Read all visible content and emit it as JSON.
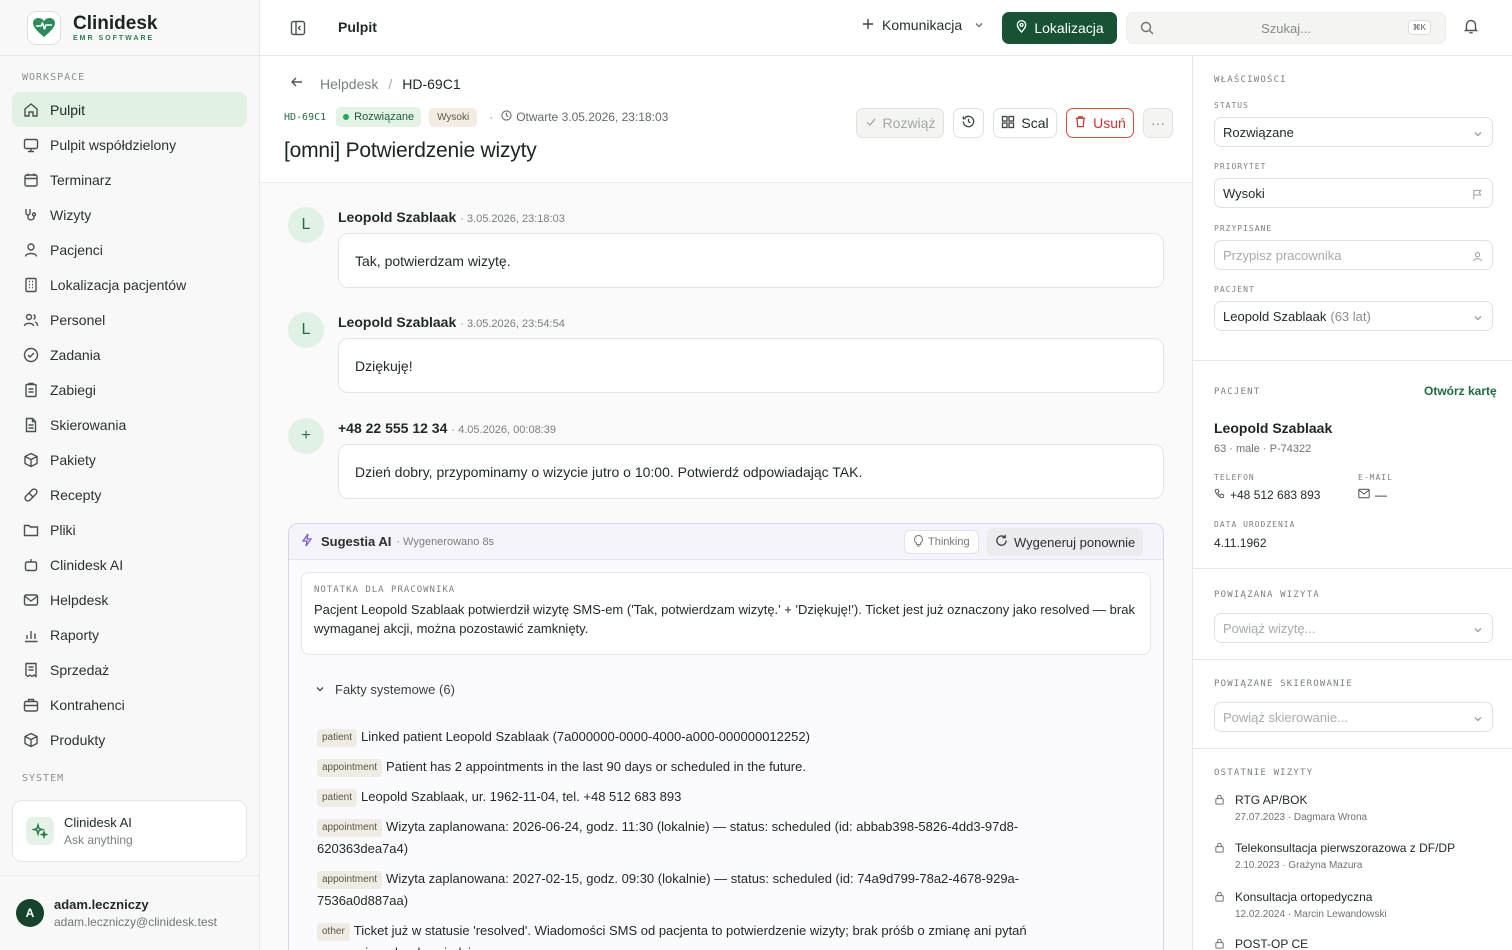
{
  "brand": {
    "name": "Clinidesk",
    "sub": "EMR SOFTWARE"
  },
  "sidebar": {
    "workspace_label": "WORKSPACE",
    "system_label": "SYSTEM",
    "items": [
      {
        "label": "Pulpit",
        "icon": "home-icon"
      },
      {
        "label": "Pulpit współdzielony",
        "icon": "monitor-icon"
      },
      {
        "label": "Terminarz",
        "icon": "calendar-icon"
      },
      {
        "label": "Wizyty",
        "icon": "stethoscope-icon"
      },
      {
        "label": "Pacjenci",
        "icon": "user-icon"
      },
      {
        "label": "Lokalizacja pacjentów",
        "icon": "building-icon"
      },
      {
        "label": "Personel",
        "icon": "users-icon"
      },
      {
        "label": "Zadania",
        "icon": "check-circle-icon"
      },
      {
        "label": "Zabiegi",
        "icon": "clipboard-icon"
      },
      {
        "label": "Skierowania",
        "icon": "file-icon"
      },
      {
        "label": "Pakiety",
        "icon": "package-icon"
      },
      {
        "label": "Recepty",
        "icon": "pill-icon"
      },
      {
        "label": "Pliki",
        "icon": "folder-icon"
      },
      {
        "label": "Clinidesk AI",
        "icon": "bot-icon"
      },
      {
        "label": "Helpdesk",
        "icon": "mail-icon"
      },
      {
        "label": "Raporty",
        "icon": "bar-chart-icon"
      },
      {
        "label": "Sprzedaż",
        "icon": "receipt-icon"
      },
      {
        "label": "Kontrahenci",
        "icon": "briefcase-icon"
      },
      {
        "label": "Produkty",
        "icon": "box-icon"
      }
    ],
    "ai_card": {
      "title": "Clinidesk AI",
      "subtitle": "Ask anything"
    },
    "user": {
      "initial": "A",
      "name": "adam.leczniczy",
      "email": "adam.leczniczy@clinidesk.test"
    }
  },
  "topbar": {
    "title": "Pulpit",
    "communication": "Komunikacja",
    "location": "Lokalizacja",
    "search_placeholder": "Szukaj...",
    "search_shortcut": "⌘K"
  },
  "ticket": {
    "breadcrumb_parent": "Helpdesk",
    "breadcrumb_current": "HD-69C1",
    "id": "HD-69C1",
    "status": "Rozwiązane",
    "priority": "Wysoki",
    "separator": "·",
    "opened": "Otwarte 3.05.2026, 23:18:03",
    "title": "[omni] Potwierdzenie wizyty",
    "actions": {
      "resolve": "Rozwiąż",
      "merge": "Scal",
      "delete": "Usuń",
      "more": "···"
    }
  },
  "messages": [
    {
      "avatar": "L",
      "author": "Leopold Szablaak",
      "time": "· 3.05.2026, 23:18:03",
      "text": "Tak, potwierdzam wizytę."
    },
    {
      "avatar": "L",
      "author": "Leopold Szablaak",
      "time": "· 3.05.2026, 23:54:54",
      "text": "Dziękuję!"
    },
    {
      "avatar": "+",
      "author": "+48 22 555 12 34",
      "time": "· 4.05.2026, 00:08:39",
      "text": "Dzień dobry, przypominamy o wizycie jutro o 10:00. Potwierdź odpowiadając TAK."
    }
  ],
  "ai": {
    "title": "Sugestia AI",
    "generated": "· Wygenerowano 8s",
    "thinking": "Thinking",
    "regenerate": "Wygeneruj ponownie",
    "note_label": "NOTATKA DLA PRACOWNIKA",
    "note_text": "Pacjent Leopold Szablaak potwierdził wizytę SMS-em ('Tak, potwierdzam wizytę.' + 'Dziękuję!'). Ticket jest już oznaczony jako resolved — brak wymaganej akcji, można pozostawić zamknięty.",
    "facts_label": "Fakty systemowe (6)",
    "facts": [
      {
        "tag": "patient",
        "text": "Linked patient Leopold Szablaak (7a000000-0000-4000-a000-000000012252)"
      },
      {
        "tag": "appointment",
        "text": "Patient has 2 appointments in the last 90 days or scheduled in the future."
      },
      {
        "tag": "patient",
        "text": "Leopold Szablaak, ur. 1962-11-04, tel. +48 512 683 893"
      },
      {
        "tag": "appointment",
        "text": "Wizyta zaplanowana: 2026-06-24, godz. 11:30 (lokalnie) — status: scheduled (id: abbab398-5826-4dd3-97d8-620363dea7a4)"
      },
      {
        "tag": "appointment",
        "text": "Wizyta zaplanowana: 2027-02-15, godz. 09:30 (lokalnie) — status: scheduled (id: 74a9d799-78a2-4678-929a-7536a0d887aa)"
      },
      {
        "tag": "other",
        "text": "Ticket już w statusie 'resolved'. Wiadomości SMS od pacjenta to potwierdzenie wizyty; brak próśb o zmianę ani pytań wymagających odpowiedzi."
      }
    ]
  },
  "properties": {
    "title": "WŁAŚCIWOŚCI",
    "status_label": "STATUS",
    "status_value": "Rozwiązane",
    "priority_label": "PRIORYTET",
    "priority_value": "Wysoki",
    "assigned_label": "PRZYPISANE",
    "assigned_placeholder": "Przypisz pracownika",
    "patient_label": "PACJENT",
    "patient_value": "Leopold Szablaak",
    "patient_age": "(63 lat)"
  },
  "patient_card": {
    "title": "PACJENT",
    "open_card": "Otwórz kartę",
    "name": "Leopold Szablaak",
    "meta": "63 · male · P-74322",
    "phone_label": "TELEFON",
    "phone": "+48 512 683 893",
    "email_label": "E-MAIL",
    "email": "—",
    "dob_label": "DATA URODZENIA",
    "dob": "4.11.1962"
  },
  "linked_visit": {
    "title": "POWIĄZANA WIZYTA",
    "placeholder": "Powiąż wizytę..."
  },
  "linked_referral": {
    "title": "POWIĄZANE SKIEROWANIE",
    "placeholder": "Powiąż skierowanie..."
  },
  "recent_visits": {
    "title": "OSTATNIE WIZYTY",
    "items": [
      {
        "name": "RTG AP/BOK",
        "sub": "27.07.2023 · Dagmara Wrona"
      },
      {
        "name": "Telekonsultacja pierwszorazowa z DF/DP",
        "sub": "2.10.2023 · Grażyna Mazura"
      },
      {
        "name": "Konsultacja ortopedyczna",
        "sub": "12.02.2024 · Marcin Lewandowski"
      },
      {
        "name": "POST-OP CE",
        "sub": ""
      }
    ]
  },
  "colors": {
    "accent": "#175235",
    "active_nav": "#e1f2e5",
    "danger": "#c7352b",
    "ai_border": "#d8d2ec"
  }
}
